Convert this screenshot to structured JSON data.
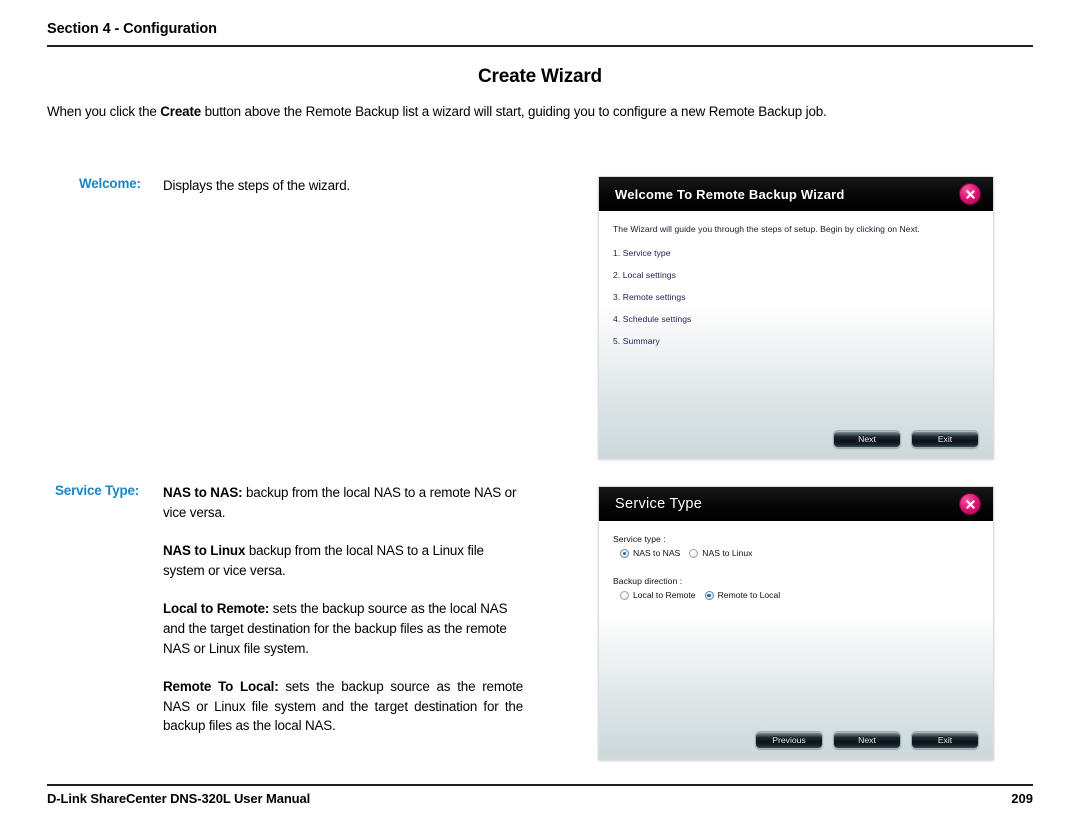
{
  "header": {
    "section": "Section 4 - Configuration"
  },
  "page": {
    "title": "Create Wizard",
    "intro_before": "When you click the ",
    "intro_bold": "Create",
    "intro_after": " button above the Remote Backup list a wizard will start, guiding you to configure a new Remote Backup job."
  },
  "rows": [
    {
      "label": "Welcome:",
      "text": "Displays the steps of the wizard."
    },
    {
      "label": "Service Type:",
      "paragraphs": [
        {
          "bold": "NAS to NAS:",
          "rest": " backup from the local NAS to a remote NAS or vice versa."
        },
        {
          "bold": "NAS to Linux",
          "rest": " backup from the local NAS to a Linux file system or vice versa."
        },
        {
          "bold": "Local to Remote:",
          "rest": " sets the backup source as the local NAS and the target destination for the backup files as the remote NAS or Linux file system."
        },
        {
          "bold": "Remote To Local:",
          "rest": " sets the backup source as the remote NAS or Linux file system and the target destination for the backup files as the local NAS."
        }
      ]
    }
  ],
  "dialog_welcome": {
    "title": "Welcome To Remote Backup Wizard",
    "close_icon": "close-icon",
    "intro": "The Wizard will guide you through the steps of setup. Begin by clicking on Next.",
    "steps": [
      "1. Service type",
      "2. Local settings",
      "3. Remote settings",
      "4. Schedule settings",
      "5. Summary"
    ],
    "buttons": [
      "Next",
      "Exit"
    ]
  },
  "dialog_service_type": {
    "title": "Service Type",
    "close_icon": "close-icon",
    "field_service_type": "Service type :",
    "service_type_options": [
      {
        "label": "NAS to NAS",
        "selected": true
      },
      {
        "label": "NAS to Linux",
        "selected": false
      }
    ],
    "field_backup_direction": "Backup direction  :",
    "backup_direction_options": [
      {
        "label": "Local to Remote",
        "selected": false
      },
      {
        "label": "Remote to Local",
        "selected": true
      }
    ],
    "buttons": [
      "Previous",
      "Next",
      "Exit"
    ]
  },
  "footer": {
    "left": "D-Link ShareCenter DNS-320L User Manual",
    "page_number": "209"
  },
  "colors": {
    "accent_label": "#1b84c4",
    "titlebar": "#000000",
    "close_button": "#e0187a",
    "radio_dot": "#1170c4"
  }
}
